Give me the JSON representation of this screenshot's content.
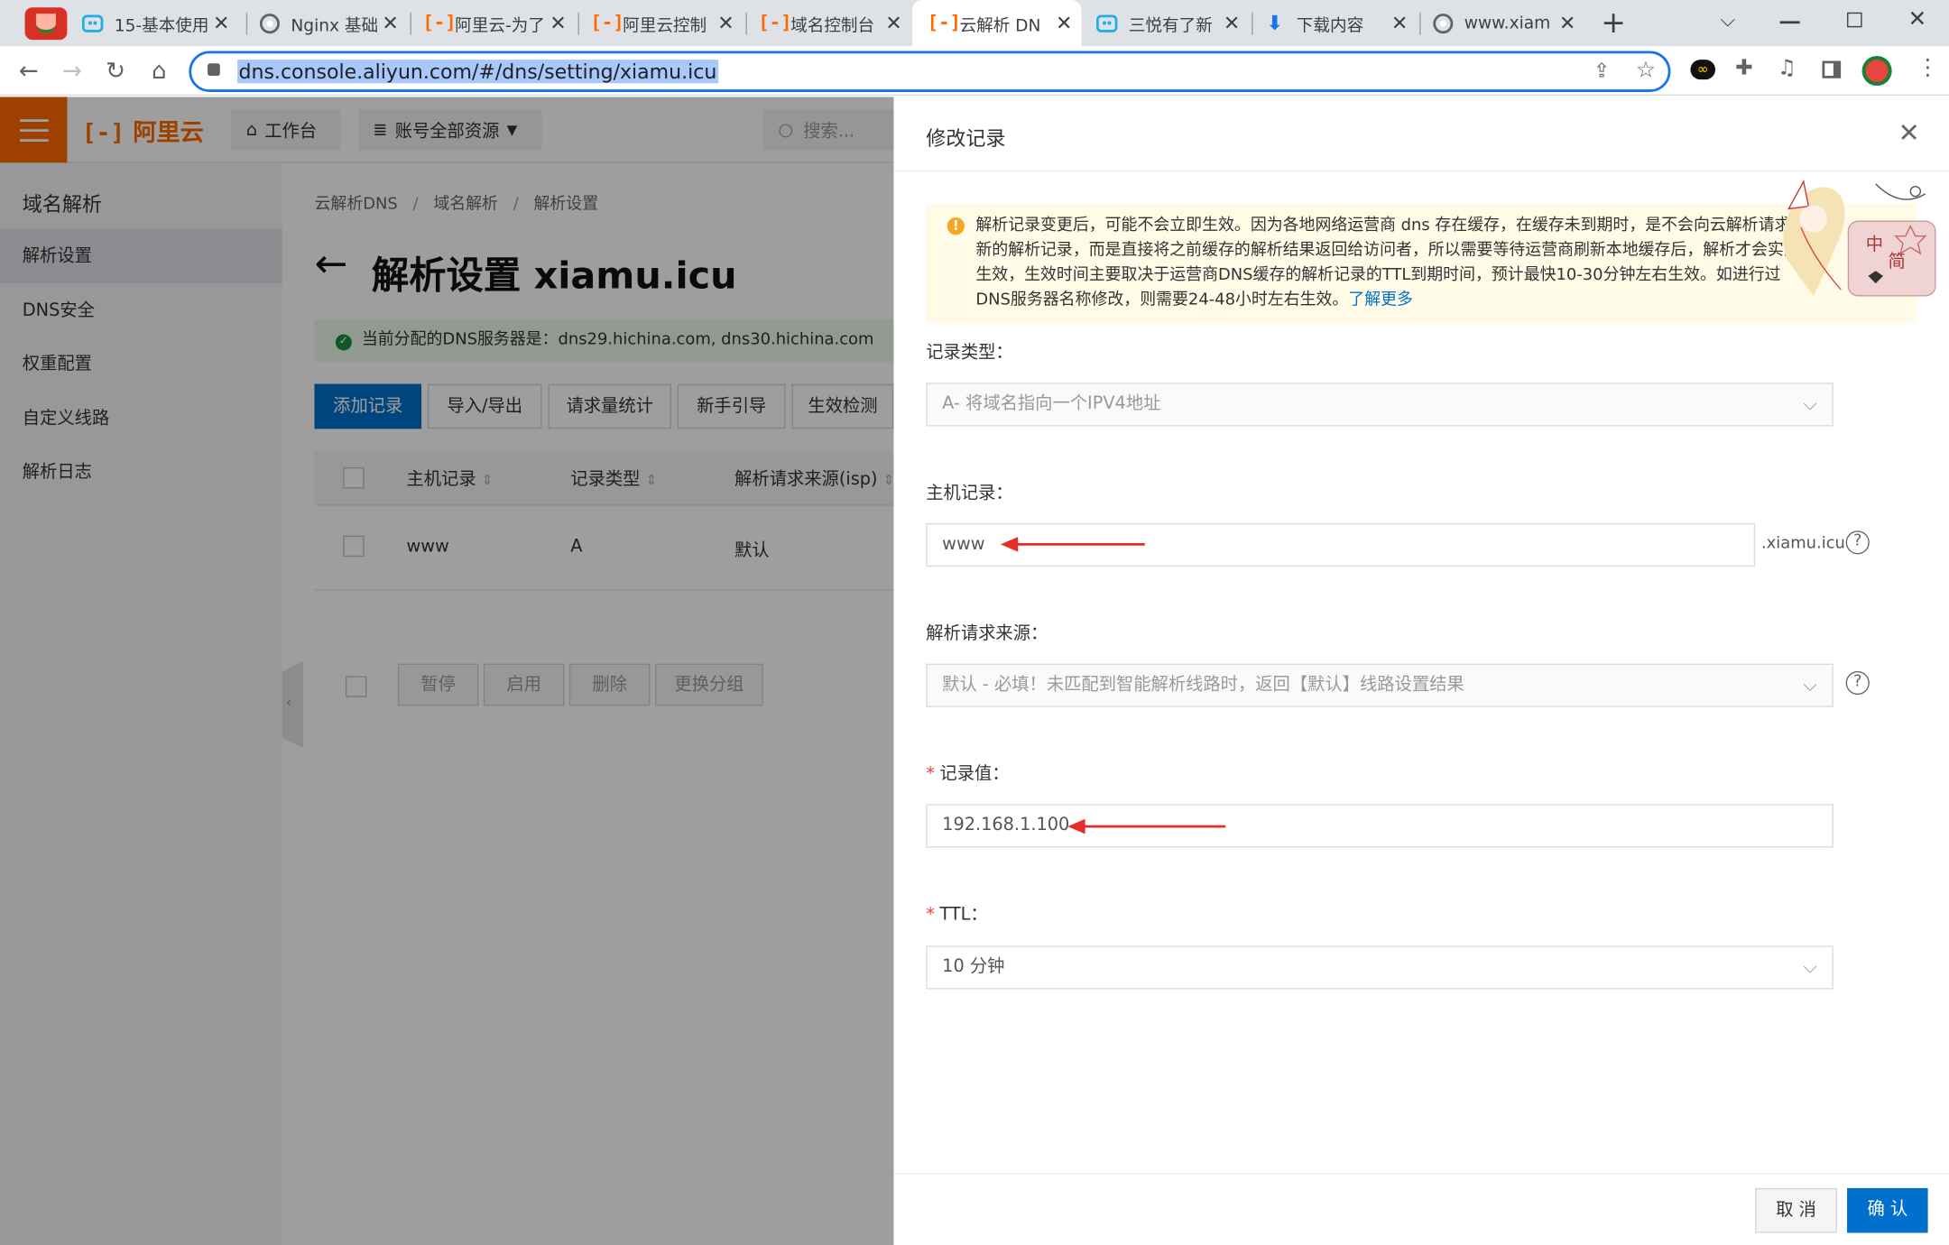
{
  "browser": {
    "tabs": [
      {
        "title": "",
        "icon": "watermelon-icon"
      },
      {
        "title": "15-基本使用",
        "icon": "bilibili-icon"
      },
      {
        "title": "Nginx 基础",
        "icon": "globe-icon"
      },
      {
        "title": "阿里云-为了",
        "icon": "aliyun-icon"
      },
      {
        "title": "阿里云控制",
        "icon": "aliyun-icon"
      },
      {
        "title": "域名控制台",
        "icon": "aliyun-icon"
      },
      {
        "title": "云解析 DN",
        "icon": "aliyun-icon"
      },
      {
        "title": "三悦有了新",
        "icon": "bilibili-icon"
      },
      {
        "title": "下载内容",
        "icon": "download-icon"
      },
      {
        "title": "www.xiam",
        "icon": "globe-icon"
      }
    ],
    "url": "dns.console.aliyun.com/#/dns/setting/xiamu.icu",
    "new_tab": "+",
    "close_glyph": "✕"
  },
  "console": {
    "logo": "阿里云",
    "workbench": "工作台",
    "account_resources": "账号全部资源",
    "search_placeholder": "搜索...",
    "sidebar_title": "域名解析",
    "sidebar": [
      {
        "label": "解析设置",
        "selected": true
      },
      {
        "label": "DNS安全"
      },
      {
        "label": "权重配置"
      },
      {
        "label": "自定义线路"
      },
      {
        "label": "解析日志"
      }
    ],
    "breadcrumb": [
      "云解析DNS",
      "域名解析",
      "解析设置"
    ],
    "page_title": "解析设置 xiamu.icu",
    "dns_server_text": "当前分配的DNS服务器是：dns29.hichina.com, dns30.hichina.com",
    "buttons": [
      "添加记录",
      "导入/导出",
      "请求量统计",
      "新手引导",
      "生效检测"
    ],
    "table": {
      "headers": [
        "主机记录",
        "记录类型",
        "解析请求来源(isp)"
      ],
      "rows": [
        [
          "www",
          "A",
          "默认"
        ]
      ]
    },
    "bulk_buttons": [
      "暂停",
      "启用",
      "删除",
      "更换分组"
    ]
  },
  "drawer": {
    "title": "修改记录",
    "notice": "解析记录变更后，可能不会立即生效。因为各地网络运营商 dns 存在缓存，在缓存未到期时，是不会向云解析请求最新的解析记录，而是直接将之前缓存的解析结果返回给访问者，所以需要等待运营商刷新本地缓存后，解析才会实际生效，生效时间主要取决于运营商DNS缓存的解析记录的TTL到期时间，预计最快10-30分钟左右生效。如进行过DNS服务器名称修改，则需要24-48小时左右生效。",
    "notice_link": "了解更多",
    "record_type_label": "记录类型：",
    "record_type_value": "A- 将域名指向一个IPV4地址",
    "host_label": "主机记录：",
    "host_value": "www",
    "host_suffix": ".xiamu.icu",
    "source_label": "解析请求来源：",
    "source_value": "默认 - 必填！未匹配到智能解析线路时，返回【默认】线路设置结果",
    "value_label": "记录值：",
    "value_value": "192.168.1.100",
    "ttl_label": "TTL：",
    "ttl_value": "10 分钟",
    "cancel": "取 消",
    "confirm": "确 认",
    "mascot_badge": [
      "中",
      "简"
    ]
  }
}
